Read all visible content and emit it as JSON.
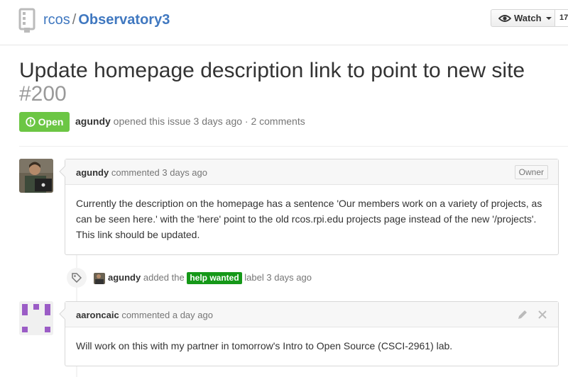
{
  "repo": {
    "owner": "rcos",
    "separator": "/",
    "name": "Observatory3",
    "watch_label": "Watch",
    "watch_count": "17"
  },
  "issue": {
    "title": "Update homepage description link to point to new site",
    "number": "#200",
    "state": "Open",
    "author": "agundy",
    "meta_text": "opened this issue 3 days ago · 2 comments"
  },
  "comments": [
    {
      "author": "agundy",
      "action": "commented 3 days ago",
      "badge": "Owner",
      "body": "Currently the description on the homepage has a sentence 'Our members work on a variety of projects, as can be seen here.' with the 'here' point to the old rcos.rpi.edu projects page instead of the new '/projects'. This link should be updated."
    },
    {
      "author": "aaroncaic",
      "action": "commented a day ago",
      "body": "Will work on this with my partner in tomorrow's Intro to Open Source (CSCI-2961) lab."
    }
  ],
  "event": {
    "author": "agundy",
    "text_before": "added the",
    "label": "help wanted",
    "text_after": "label 3 days ago"
  },
  "colors": {
    "link": "#4078c0",
    "open_state": "#6cc644",
    "help_wanted_label": "#159818"
  }
}
